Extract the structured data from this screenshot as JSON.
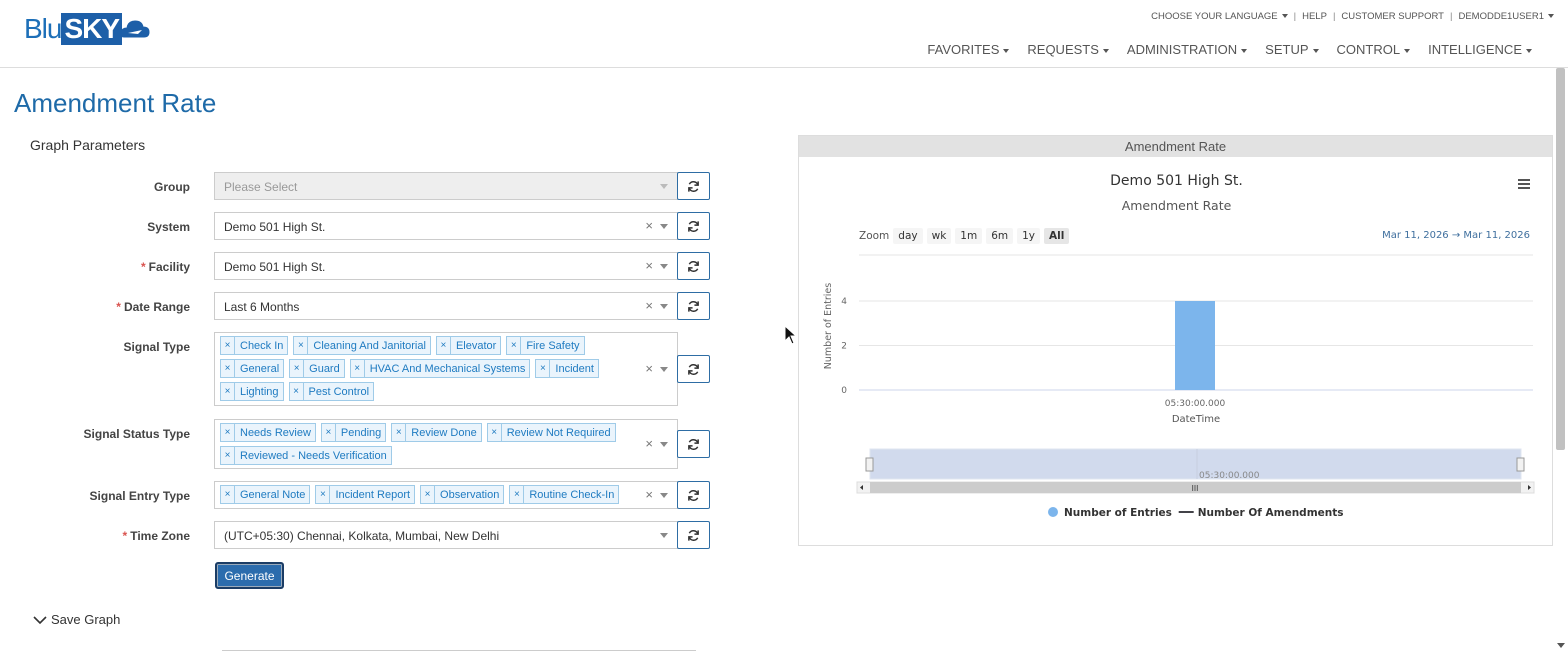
{
  "brand": {
    "part1": "Blu",
    "part2": "SKY"
  },
  "toplinks": {
    "language": "CHOOSE YOUR LANGUAGE",
    "help": "HELP",
    "support": "CUSTOMER SUPPORT",
    "user": "DEMODDE1USER1"
  },
  "nav": [
    "FAVORITES",
    "REQUESTS",
    "ADMINISTRATION",
    "SETUP",
    "CONTROL",
    "INTELLIGENCE"
  ],
  "page": {
    "title": "Amendment Rate",
    "params_title": "Graph Parameters"
  },
  "form": {
    "group": {
      "label": "Group",
      "placeholder": "Please Select"
    },
    "system": {
      "label": "System",
      "value": "Demo 501 High St."
    },
    "facility": {
      "label": "Facility",
      "value": "Demo 501 High St."
    },
    "date_range": {
      "label": "Date Range",
      "value": "Last 6 Months"
    },
    "signal_type": {
      "label": "Signal Type",
      "tags": [
        "Check In",
        "Cleaning And Janitorial",
        "Elevator",
        "Fire Safety",
        "General",
        "Guard",
        "HVAC And Mechanical Systems",
        "Incident",
        "Lighting",
        "Pest Control"
      ]
    },
    "signal_status_type": {
      "label": "Signal Status Type",
      "tags": [
        "Needs Review",
        "Pending",
        "Review Done",
        "Review Not Required",
        "Reviewed - Needs Verification"
      ]
    },
    "signal_entry_type": {
      "label": "Signal Entry Type",
      "tags": [
        "General Note",
        "Incident Report",
        "Observation",
        "Routine Check-In"
      ]
    },
    "time_zone": {
      "label": "Time Zone",
      "value": "(UTC+05:30) Chennai, Kolkata, Mumbai, New Delhi"
    },
    "generate_label": "Generate",
    "save_graph_label": "Save Graph"
  },
  "panel": {
    "header": "Amendment Rate",
    "zoom_label": "Zoom",
    "zoom_buttons": [
      "day",
      "wk",
      "1m",
      "6m",
      "1y",
      "All"
    ],
    "zoom_active": "All",
    "range_from": "Mar 11, 2026",
    "range_to": "Mar 11, 2026"
  },
  "chart_data": {
    "type": "bar",
    "title": "Demo 501 High St.",
    "subtitle": "Amendment Rate",
    "xlabel": "DateTime",
    "ylabel": "Number of Entries",
    "categories": [
      "05:30:00.000"
    ],
    "series": [
      {
        "name": "Number of Entries",
        "type": "bar",
        "color": "#7cb5ec",
        "values": [
          4
        ]
      },
      {
        "name": "Number Of Amendments",
        "type": "line",
        "color": "#434348",
        "values": [
          0
        ]
      }
    ],
    "ylim": [
      0,
      4
    ],
    "yticks": [
      0,
      2,
      4
    ],
    "navigator_label": "05:30:00.000",
    "grid": true,
    "legend": "bottom-center"
  }
}
